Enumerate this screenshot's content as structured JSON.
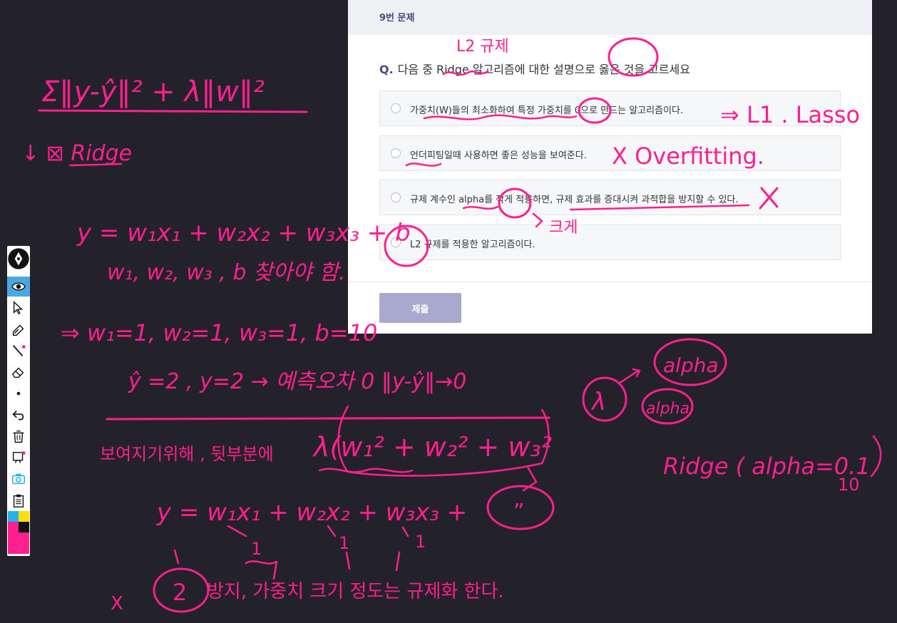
{
  "quiz": {
    "problem_number": "9번 문제",
    "question_label": "Q.",
    "question_text": "다음 중 Ridge 알고리즘에 대한 설명으로 옳은 것을 고르세요",
    "options": [
      "가중치(W)들의 최소화하여 특정 가중치를 0으로 만드는 알고리즘이다.",
      "언더피팅일때 사용하면 좋은 성능을 보여준다.",
      "규제 계수인 alpha를 작게 적용하면, 규제 효과를 증대시켜 과적합을 방지할 수 있다.",
      "L2 규제를 적용한 알고리즘이다."
    ],
    "submit_label": "제출"
  },
  "toolbar": {
    "tools": [
      "pen-logo-icon",
      "eye-icon",
      "cursor-icon",
      "highlighter-icon",
      "pen-icon",
      "eraser-icon",
      "dot-icon",
      "undo-icon",
      "trash-icon",
      "screen-icon",
      "camera-icon",
      "clipboard-icon"
    ],
    "colors": {
      "accent": "#ff1f8f",
      "cyan": "#1fb3e8",
      "yellow": "#ffe000",
      "black": "#111111",
      "magenta": "#ff1f8f"
    }
  },
  "annotations": {
    "formula_top": "Σ‖y-ŷ‖² + λ‖w‖²",
    "ridge_label": "↓ ⊠ Ridge",
    "l2_note": "L2 규제",
    "l1_lasso": "⇒ L1 . Lasso",
    "overfitting": "X  Overfitting.",
    "size_note": "크게",
    "linear_eq": "y = w₁x₁ + w₂x₂ + w₃x₃ + b",
    "weights_note": "w₁, w₂, w₃ , b 찾아야 함.",
    "weights_values": "⇒   w₁=1,  w₂=1,  w₃=1,   b=10",
    "prediction": "ŷ =2 ,     y=2   →   예측오차 0    ‖y-ŷ‖→0",
    "penalty_left": "보여지기위해 , 뒷부분에",
    "penalty_term": "λ(w₁² + w₂² + w₃²",
    "alpha1": "alpha",
    "alpha2": "alpha",
    "lambda": "λ",
    "ridge_alpha": "Ridge ( alpha=0.1",
    "ridge_alpha_10": "10",
    "eq_bottom": "y = w₁x₁ + w₂x₂ + w₃x₃ + ",
    "eq_bottom_end": "”",
    "ones_a": "1",
    "ones_b": "1",
    "ones_c": "1",
    "bottom_x": "X",
    "bottom_two": "2",
    "bottom_note": "방지,    가중치 크기 정도는 규제화 한다."
  }
}
